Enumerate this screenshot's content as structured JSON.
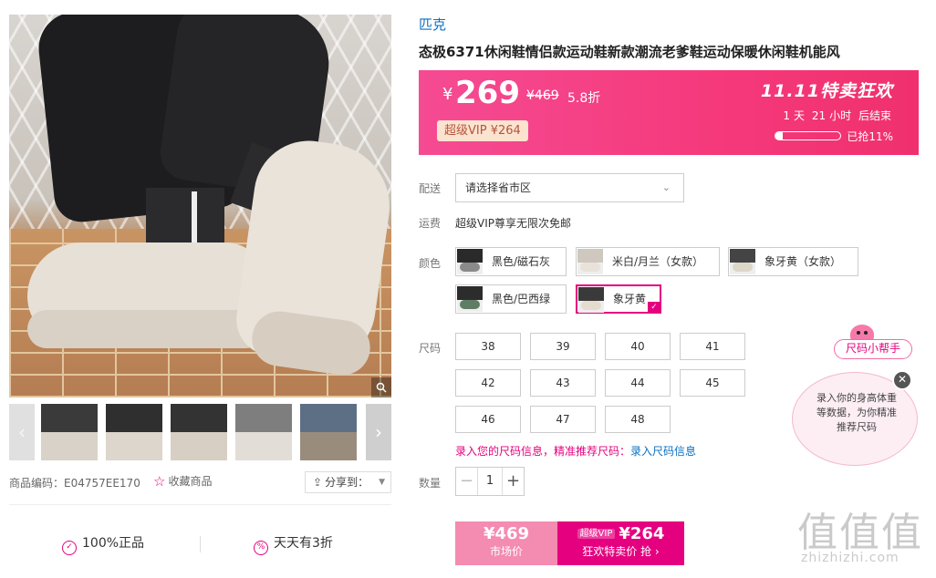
{
  "gallery": {
    "zoom_icon": "search-icon",
    "thumb_prev": "‹",
    "thumb_next": "›",
    "thumbnails": [
      {
        "colors": [
          "#3a3a3a",
          "#d9d2c8"
        ]
      },
      {
        "colors": [
          "#2f2f2f",
          "#ddd6cc"
        ]
      },
      {
        "colors": [
          "#333333",
          "#d7cfc4"
        ]
      },
      {
        "colors": [
          "#7e7e7e",
          "#e2ddd7"
        ]
      },
      {
        "colors": [
          "#5d6f84",
          "#9a8c7c"
        ]
      }
    ]
  },
  "product_meta": {
    "code": "商品编码：E04757EE170",
    "favorite": "收藏商品",
    "share": "分享到："
  },
  "guarantees": [
    {
      "icon": "shield-check-icon",
      "label": "100%正品"
    },
    {
      "icon": "percent-icon",
      "label": "天天有3折"
    }
  ],
  "brand": "匹克",
  "title": "态极6371休闲鞋情侣款运动鞋新款潮流老爹鞋运动保暖休闲鞋机能风",
  "price_box": {
    "currency": "¥",
    "price": "269",
    "original": "¥469",
    "discount": "5.8折",
    "vip_tag": "超级VIP ¥264",
    "promo_title": "11.11特卖狂欢",
    "countdown": {
      "days": "1",
      "day_label": "天",
      "hours": "21",
      "hour_label": "小时",
      "suffix": "后结束"
    },
    "sold_progress": 0.11,
    "sold_text": "已抢11%"
  },
  "delivery": {
    "label": "配送",
    "placeholder": "请选择省市区",
    "shipping_label": "运费",
    "shipping_text": "超级VIP尊享无限次免邮"
  },
  "colors": {
    "label": "颜色",
    "options": [
      {
        "name": "黑色/磁石灰",
        "swatch": [
          "#2a2a2a",
          "#8a8a8a"
        ]
      },
      {
        "name": "米白/月兰（女款）",
        "swatch": [
          "#cfc8be",
          "#e8e2da"
        ]
      },
      {
        "name": "象牙黄（女款）",
        "swatch": [
          "#444444",
          "#ded6c9"
        ]
      },
      {
        "name": "黑色/巴西绿",
        "swatch": [
          "#2c2c2c",
          "#5f7d64"
        ]
      },
      {
        "name": "象牙黄",
        "swatch": [
          "#3a3a3a",
          "#e4dccf"
        ],
        "selected": true
      }
    ]
  },
  "sizes": {
    "label": "尺码",
    "options": [
      "38",
      "39",
      "40",
      "41",
      "42",
      "43",
      "44",
      "45",
      "46",
      "47",
      "48"
    ],
    "tip": "录入您的尺码信息，精准推荐尺码：",
    "tip_link": "录入尺码信息"
  },
  "quantity": {
    "label": "数量",
    "value": "1",
    "minus": "−",
    "plus": "+"
  },
  "buy": {
    "market_price": "¥469",
    "market_label": "市场价",
    "vip_badge": "超级VIP",
    "sale_price": "¥264",
    "sale_label": "狂欢特卖价 抢 ›"
  },
  "size_helper": {
    "badge": "尺码小帮手",
    "close": "✕",
    "text": "录入你的身高体重等数据，为你精准推荐尺码"
  },
  "watermark": {
    "big": "值值值",
    "small": "zhizhizhi.com"
  },
  "theme": {
    "accent": "#e5007f",
    "link": "#0a6fc2"
  }
}
